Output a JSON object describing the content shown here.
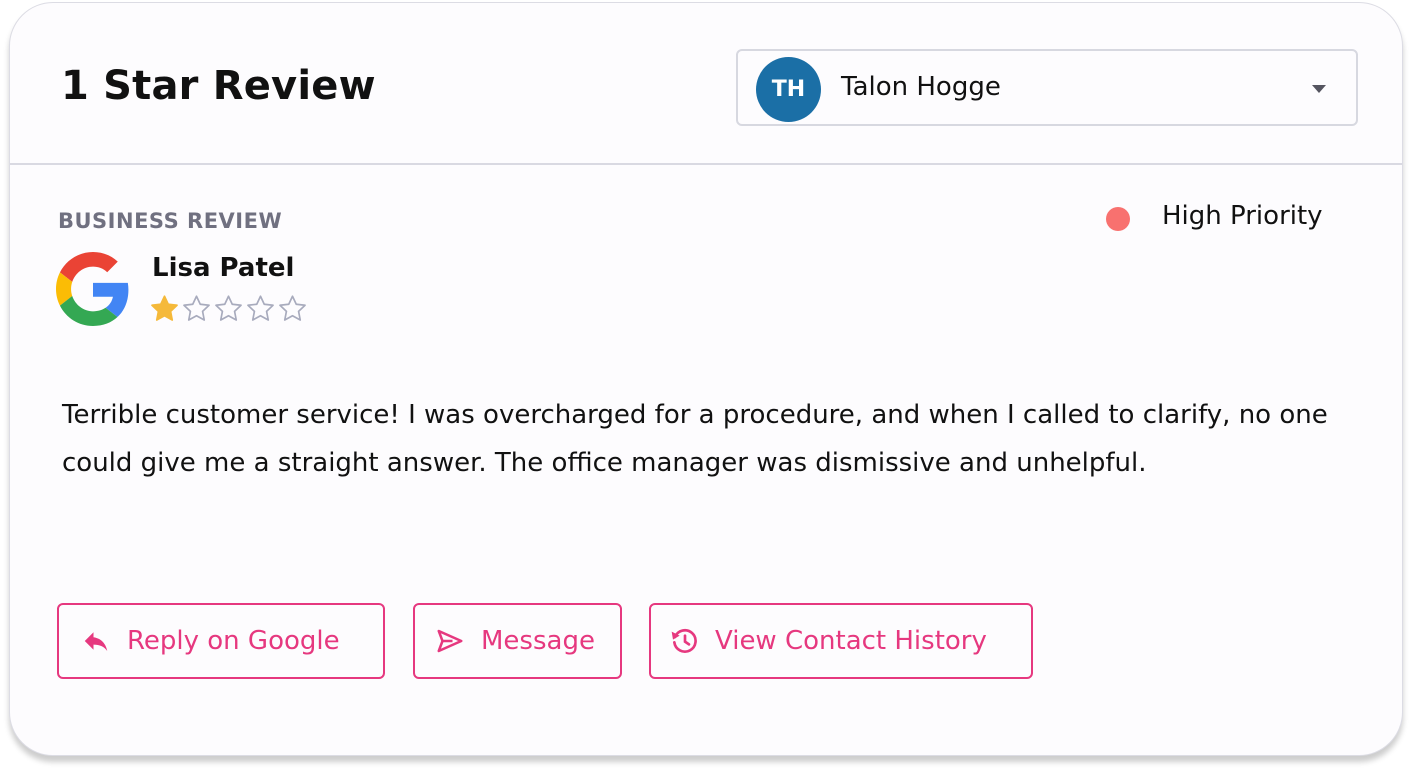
{
  "header": {
    "title": "1 Star Review",
    "assignee": {
      "initials": "TH",
      "name": "Talon Hogge",
      "avatar_color": "#1b6fa6"
    }
  },
  "review": {
    "section_label": "BUSINESS REVIEW",
    "source_icon": "google-logo",
    "reviewer_name": "Lisa Patel",
    "rating": 1,
    "rating_max": 5,
    "priority": {
      "label": "High Priority",
      "color": "#f8716f"
    },
    "text": "Terrible customer service! I was overcharged for a procedure, and when I called to clarify, no one could give me a straight answer. The office manager was dismissive and unhelpful."
  },
  "actions": {
    "reply_label": "Reply on Google",
    "message_label": "Message",
    "history_label": "View Contact History",
    "accent_color": "#e6387f"
  }
}
